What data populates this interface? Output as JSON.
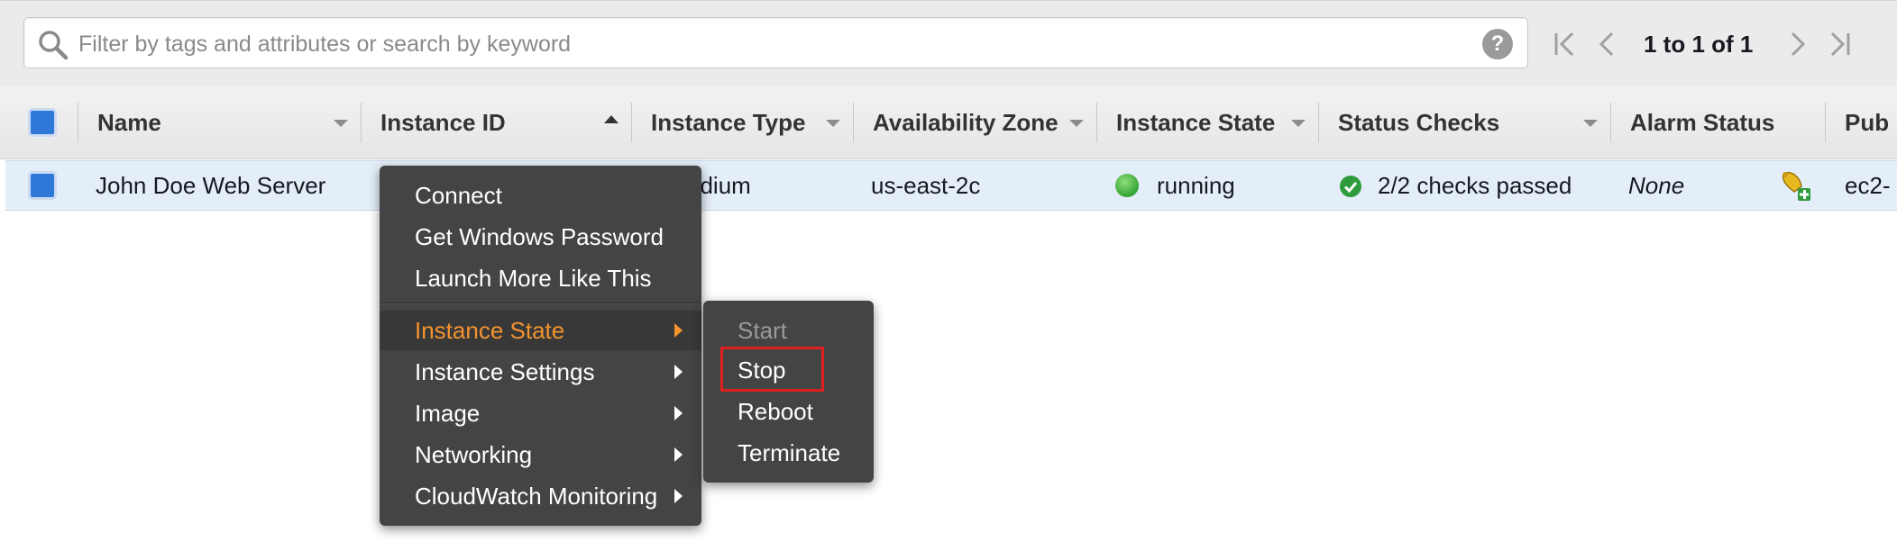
{
  "search": {
    "placeholder": "Filter by tags and attributes or search by keyword",
    "help_label": "?"
  },
  "pagination": {
    "text": "1 to 1 of 1"
  },
  "table": {
    "columns": [
      {
        "label": "Name"
      },
      {
        "label": "Instance ID"
      },
      {
        "label": "Instance Type"
      },
      {
        "label": "Availability Zone"
      },
      {
        "label": "Instance State"
      },
      {
        "label": "Status Checks"
      },
      {
        "label": "Alarm Status"
      },
      {
        "label": "Pub"
      }
    ],
    "rows": [
      {
        "name": "John Doe Web Server",
        "instance_type_partial": "edium",
        "availability_zone": "us-east-2c",
        "instance_state": "running",
        "status_checks": "2/2 checks passed",
        "alarm_status": "None",
        "public_dns_partial": "ec2-"
      }
    ]
  },
  "context_menu": {
    "items": [
      {
        "label": "Connect"
      },
      {
        "label": "Get Windows Password"
      },
      {
        "label": "Launch More Like This"
      },
      {
        "label": "Instance State",
        "submenu": true,
        "active": true
      },
      {
        "label": "Instance Settings",
        "submenu": true
      },
      {
        "label": "Image",
        "submenu": true
      },
      {
        "label": "Networking",
        "submenu": true
      },
      {
        "label": "CloudWatch Monitoring",
        "submenu": true
      }
    ]
  },
  "submenu": {
    "items": [
      {
        "label": "Start",
        "disabled": true
      },
      {
        "label": "Stop",
        "highlighted": true
      },
      {
        "label": "Reboot"
      },
      {
        "label": "Terminate"
      }
    ]
  },
  "colors": {
    "accent_orange": "#f2932f",
    "menu_bg": "#444444",
    "selected_row": "#e4eef9",
    "checkbox_blue": "#2e78d8",
    "running_green": "#3bb44a",
    "highlight_red": "#e02020"
  },
  "icons": {
    "search": "magnifier-icon",
    "help": "help-icon",
    "first_page": "first-page-icon",
    "prev_page": "prev-page-icon",
    "next_page": "next-page-icon",
    "last_page": "last-page-icon",
    "alarm": "create-alarm-icon",
    "status_ok": "check-circle-icon",
    "running": "running-dot-icon"
  }
}
